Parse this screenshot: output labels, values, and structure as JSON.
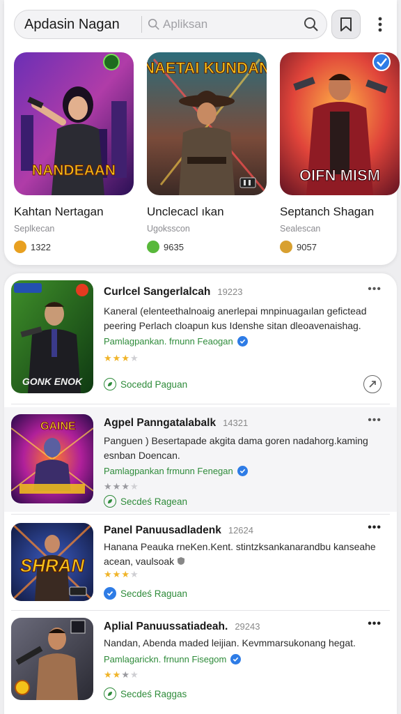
{
  "header": {
    "app_title": "Apdasin Nagan",
    "search_placeholder": "Apliksan",
    "icons": [
      "search-icon",
      "bookmark-icon",
      "more-vertical-icon"
    ]
  },
  "featured": [
    {
      "banner_text": "NANDEAAN",
      "name": "Kahtan Nertagan",
      "sub": "Seplkecan",
      "count": "1322",
      "badge_icon": "green-circle-badge-icon",
      "emoji_icon": "angry-emoji-icon"
    },
    {
      "banner_text": "NAETAI KUNDAN",
      "name": "Unclecacl ıkan",
      "sub": "Ugoksscon",
      "count": "9635",
      "badge_icon": "pause-badge-icon",
      "emoji_icon": "grin-emoji-icon"
    },
    {
      "banner_text": "OIFN MISM",
      "name": "Septanch Shagan",
      "sub": "Sealescan",
      "count": "9057",
      "badge_icon": "blue-check-badge-icon",
      "emoji_icon": "surprised-emoji-icon"
    }
  ],
  "list": [
    {
      "banner_text": "GONK ENOK",
      "title": "Curlcel Sangerlalcah",
      "num": "19223",
      "desc": "Kaneral (elenteethalnoaig anerlepai mnpinuagaılan gefictead peering Perlach cloapun kus Idenshe sitan dleoavenaishag.",
      "developer": "Pamlagpankan. frnunn Feaogan",
      "rating": 3,
      "status": "Socedd Paguan",
      "status_icon": "leaf-icon",
      "action_icon": "share-icon"
    },
    {
      "banner_text": "GAINE",
      "title": "Agpel Panngatalabalk",
      "num": "14321",
      "desc": "Panguen ) Besertapade akgita dama goren nadahorg.kaming esnban Doencan.",
      "developer": "Pamlagpankan frmunn Fenegan",
      "rating": 3,
      "status": "Secdeś Ragean",
      "status_icon": "leaf-icon",
      "action_icon": "more-horizontal-icon"
    },
    {
      "banner_text": "SHRAN",
      "title": "Panel Panuusadladenk",
      "num": "12624",
      "desc": "Hanana Peauka rneKen.Kent. stintzksankanarandbu kanseahe acean, vaulsoak",
      "developer": "",
      "rating": 3,
      "status": "Secdeś Raguan",
      "status_icon": "check-circle-icon",
      "action_icon": "more-horizontal-icon"
    },
    {
      "banner_text": "",
      "title": "Aplial Panuussatiadeah.",
      "num": "29243",
      "desc": "Nandan, Abenda maded leijian. Kevmmarsukonang hegat.",
      "developer": "Pamlagarickn. frnunn Fisegom",
      "rating": 3,
      "status": "Secdeś Raggas",
      "status_icon": "leaf-icon",
      "action_icon": "more-horizontal-icon"
    }
  ],
  "colors": {
    "accent_green": "#2e8b3a",
    "verified_blue": "#2e7ce6",
    "star": "#f0b429"
  }
}
